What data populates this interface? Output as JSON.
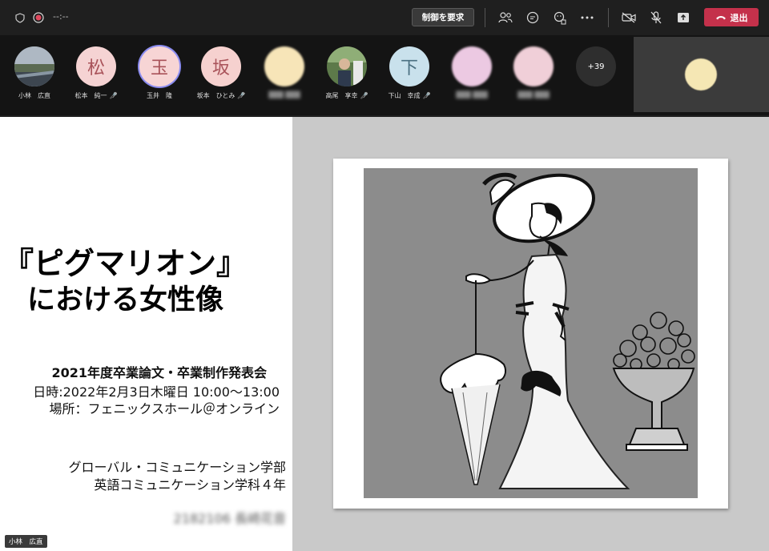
{
  "topbar": {
    "timer": "--:--",
    "request_control_label": "制御を要求",
    "leave_label": "退出",
    "leave_color": "#c4314b"
  },
  "participants": [
    {
      "name": "小林　広直",
      "initial": "",
      "color": "#6c7a86",
      "photo": true,
      "muted": false,
      "blurred": false
    },
    {
      "name": "松本　純一",
      "initial": "松",
      "color": "#f5d3d3",
      "muted": true,
      "blurred": false
    },
    {
      "name": "玉井　隆",
      "initial": "玉",
      "color": "#f7d5d5",
      "muted": false,
      "blurred": false,
      "active": true
    },
    {
      "name": "坂本　ひとみ",
      "initial": "坂",
      "color": "#f6d1cf",
      "muted": true,
      "blurred": false
    },
    {
      "name": "",
      "initial": "",
      "color": "#f7e5b8",
      "muted": false,
      "blurred": true
    },
    {
      "name": "高尾　享幸",
      "initial": "",
      "color": "#4a5d3c",
      "photo": true,
      "muted": true,
      "blurred": false
    },
    {
      "name": "下山　幸成",
      "initial": "下",
      "color": "#c9e1ec",
      "muted": true,
      "blurred": false
    },
    {
      "name": "",
      "initial": "",
      "color": "#ecc9e2",
      "muted": true,
      "blurred": true
    },
    {
      "name": "",
      "initial": "",
      "color": "#f0cfd8",
      "muted": true,
      "blurred": true
    }
  ],
  "more_count": "+39",
  "slide": {
    "title_line1": "『ピグマリオン』",
    "title_line2": "における女性像",
    "event_name": "2021年度卒業論文・卒業制作発表会",
    "datetime": "日時:2022年2月3日木曜日 10:00〜13:00",
    "place": "場所：フェニックスホール＠オンライン",
    "faculty": "グローバル・コミュニケーション学部",
    "department": "英語コミュニケーション学科４年",
    "student": "2182106 長崎花音"
  },
  "speaker_tag": "小林　広直"
}
